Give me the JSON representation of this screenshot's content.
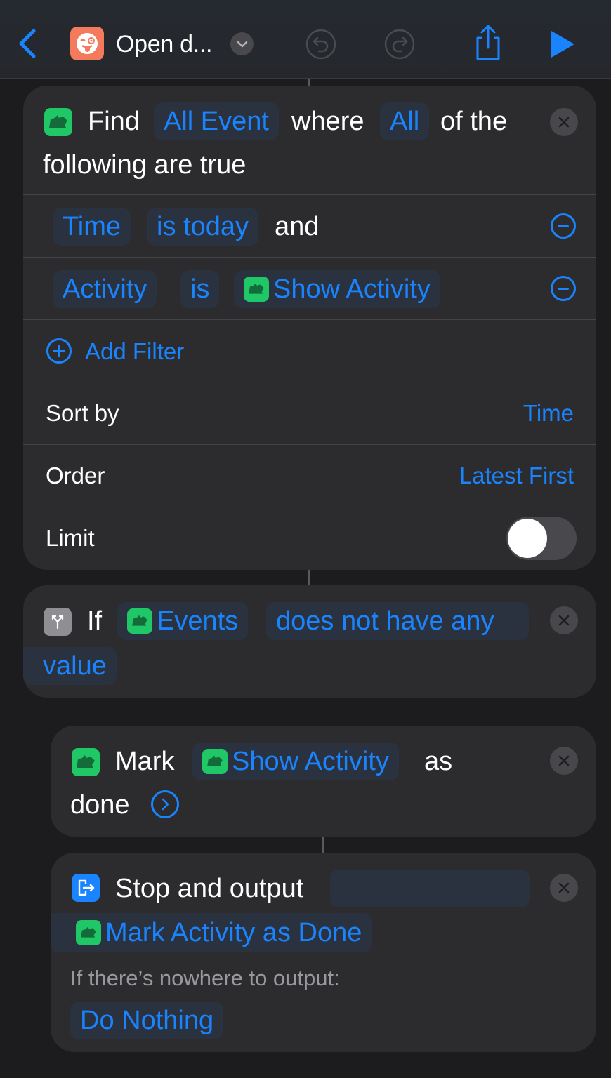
{
  "navbar": {
    "title": "Open d...",
    "back_icon": "chevron-left-icon",
    "app_icon": "winking-face-tongue-icon",
    "dropdown_icon": "chevron-down-icon",
    "undo_icon": "undo-icon",
    "redo_icon": "redo-icon",
    "share_icon": "share-icon",
    "run_icon": "play-icon"
  },
  "find_action": {
    "verb": "Find",
    "entity": "All Event",
    "where": "where",
    "quantifier": "All",
    "of_the": "of the",
    "line2": "following are true",
    "filters": [
      {
        "property": "Time",
        "operator": "is today",
        "conjunction": "and"
      },
      {
        "property": "Activity",
        "operator": "is",
        "value": "Show Activity"
      }
    ],
    "add_filter": "Add Filter",
    "sort_by_label": "Sort by",
    "sort_by_value": "Time",
    "order_label": "Order",
    "order_value": "Latest First",
    "limit_label": "Limit",
    "limit_enabled": false
  },
  "if_action": {
    "keyword": "If",
    "variable": "Events",
    "condition_line1": "does not have any",
    "condition_line2": "value"
  },
  "mark_action": {
    "verb": "Mark",
    "target": "Show Activity",
    "as": "as",
    "line2": "done"
  },
  "stop_action": {
    "title": "Stop and output",
    "output_value": "Mark Activity as Done",
    "fallback_label": "If there’s nowhere to output:",
    "fallback_value": "Do Nothing"
  },
  "colors": {
    "accent": "#1a84ff",
    "background": "#1c1c1e",
    "card": "#2c2c2e",
    "app_green": "#1fc767",
    "shortcut_icon": "#f47a5e"
  }
}
